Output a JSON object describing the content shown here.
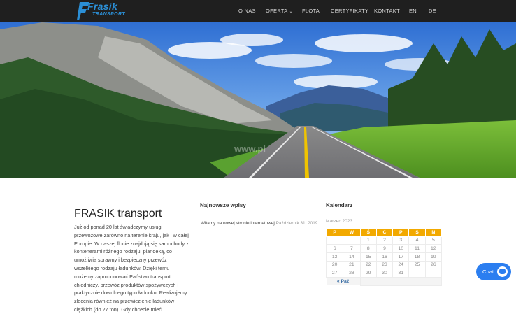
{
  "header": {
    "logo_text": "Frasik",
    "logo_subtext": "TRANSPORT",
    "nav": [
      {
        "label": "O NAS"
      },
      {
        "label": "OFERTA",
        "has_dropdown": true
      },
      {
        "label": "FLOTA"
      },
      {
        "label": "CERTYFIKATY"
      },
      {
        "label": "KONTAKT"
      },
      {
        "label": "EN"
      },
      {
        "label": "DE"
      }
    ],
    "dropdown_icon": "chevron-down-icon"
  },
  "hero": {
    "image": "mountain-highway-landscape",
    "watermark_text": "www.pl"
  },
  "about": {
    "title": "FRASIK transport",
    "text": "Już od ponad 20 lat świadczymy usługi przewozowe zarówno na terenie kraju, jak i w całej Europie. W naszej flocie znajdują się samochody z kontenerami różnego rodzaju, plandeką, co umożliwia sprawny i bezpieczny przewóz wszelkiego rodzaju ładunków. Dzięki temu możemy zaproponować Państwu transport chłodniczy, przewóz produktów spożywczych i praktycznie dowolnego typu ładunku. Realizujemy zlecenia również na przewiezienie ładunków ciężkich (do 27 ton). Gdy chcecie mieć"
  },
  "latest_posts": {
    "title": "Najnowsze wpisy",
    "items": [
      {
        "title": "Witamy na nowej stronie internetowej",
        "date": "Październik 31, 2019"
      }
    ]
  },
  "calendar": {
    "title": "Kalendarz",
    "caption": "Marzec 2023",
    "weekdays": [
      "P",
      "W",
      "Ś",
      "C",
      "P",
      "S",
      "N"
    ],
    "rows": [
      [
        "",
        "",
        "1",
        "2",
        "3",
        "4",
        "5"
      ],
      [
        "6",
        "7",
        "8",
        "9",
        "10",
        "11",
        "12"
      ],
      [
        "13",
        "14",
        "15",
        "16",
        "17",
        "18",
        "19"
      ],
      [
        "20",
        "21",
        "22",
        "23",
        "24",
        "25",
        "26"
      ],
      [
        "27",
        "28",
        "29",
        "30",
        "31",
        "",
        ""
      ]
    ],
    "prev_link": "« Paź"
  },
  "chat_widget": {
    "label": "Chat",
    "icon": "chat-bubble-icon",
    "color": "#2b7ef0"
  },
  "colors": {
    "header_bg": "#1f1f1f",
    "logo": "#2b8fd6",
    "calendar_header": "#f2a900"
  }
}
